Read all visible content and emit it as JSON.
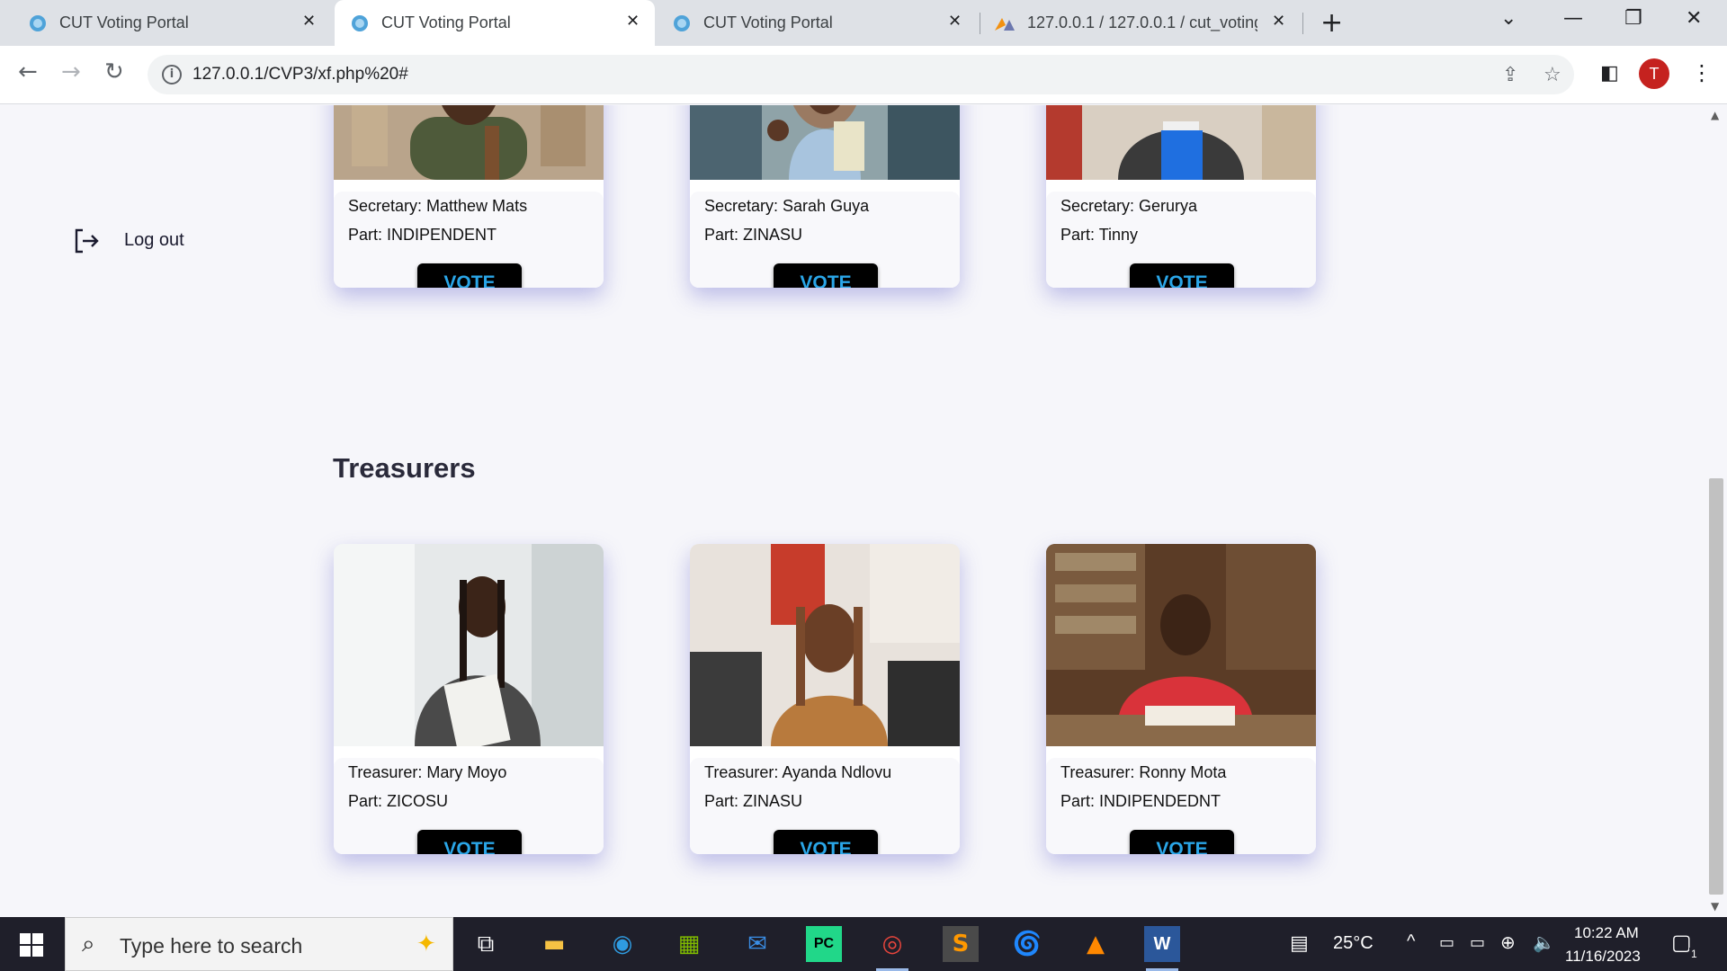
{
  "browser": {
    "tabs": [
      {
        "title": "CUT Voting Portal",
        "active": false
      },
      {
        "title": "CUT Voting Portal",
        "active": true
      },
      {
        "title": "CUT Voting Portal",
        "active": false
      },
      {
        "title": "127.0.0.1 / 127.0.0.1 / cut_voting",
        "active": false
      }
    ],
    "url": "127.0.0.1/CVP3/xf.php%20#",
    "profile_initial": "T"
  },
  "sidebar": {
    "logout_label": "Log out"
  },
  "secretaries": [
    {
      "role_line": "Secretary: Matthew Mats",
      "party_line": "Part: INDIPENDENT",
      "vote_label": "VOTE"
    },
    {
      "role_line": "Secretary: Sarah Guya",
      "party_line": "Part: ZINASU",
      "vote_label": "VOTE"
    },
    {
      "role_line": "Secretary: Gerurya",
      "party_line": "Part: Tinny",
      "vote_label": "VOTE"
    }
  ],
  "treasurers_section": {
    "heading": "Treasurers",
    "candidates": [
      {
        "role_line": "Treasurer: Mary Moyo",
        "party_line": "Part: ZICOSU",
        "vote_label": "VOTE"
      },
      {
        "role_line": "Treasurer: Ayanda Ndlovu",
        "party_line": "Part: ZINASU",
        "vote_label": "VOTE"
      },
      {
        "role_line": "Treasurer: Ronny Mota",
        "party_line": "Part: INDIPENDEDNT",
        "vote_label": "VOTE"
      }
    ]
  },
  "taskbar": {
    "search_placeholder": "Type here to search",
    "weather": "25°C",
    "time": "10:22 AM",
    "date": "11/16/2023",
    "notification_count": "1"
  },
  "colors": {
    "vote_text": "#2aa6e8",
    "vote_bg": "#000000",
    "card_shadow": "#7878d2",
    "page_bg": "#f6f6fa"
  }
}
